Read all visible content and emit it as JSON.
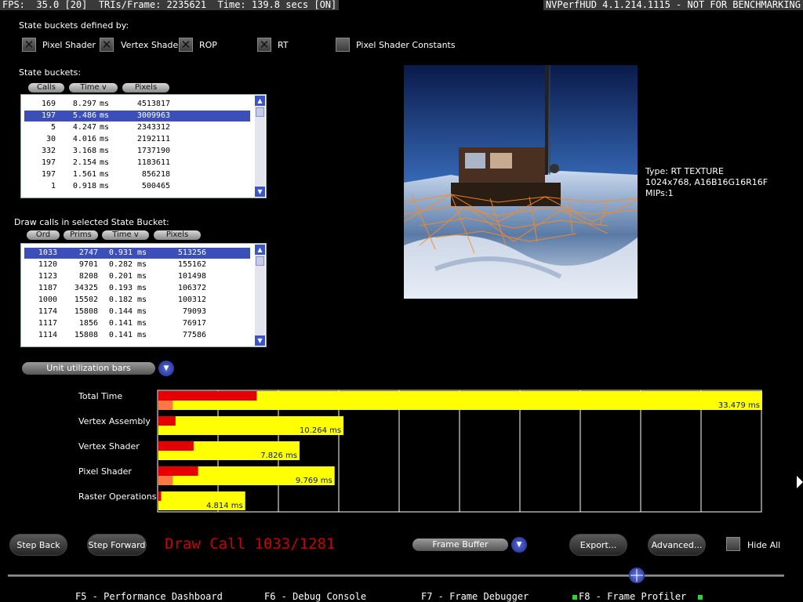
{
  "topbar": {
    "stats": "FPS:  35.0 [20]  TRIs/Frame: 2235621  Time: 139.8 secs [ON]",
    "version": "NVPerfHUD 4.1.214.1115 - NOT FOR BENCHMARKING"
  },
  "state_defined": {
    "title": "State buckets defined by:",
    "options": [
      {
        "label": "Pixel Shader",
        "checked": true
      },
      {
        "label": "Vertex Shader",
        "checked": true
      },
      {
        "label": "ROP",
        "checked": true
      },
      {
        "label": "RT",
        "checked": true
      },
      {
        "label": "Pixel Shader Constants",
        "checked": false
      }
    ]
  },
  "state_buckets": {
    "title": "State buckets:",
    "columns": [
      "Calls",
      "Time v",
      "Pixels"
    ],
    "rows": [
      [
        "169",
        "8.297",
        "ms",
        "4513817"
      ],
      [
        "197",
        "5.486",
        "ms",
        "3009963"
      ],
      [
        "5",
        "4.247",
        "ms",
        "2343312"
      ],
      [
        "30",
        "4.016",
        "ms",
        "2192111"
      ],
      [
        "332",
        "3.168",
        "ms",
        "1737190"
      ],
      [
        "197",
        "2.154",
        "ms",
        "1183611"
      ],
      [
        "197",
        "1.561",
        "ms",
        "856218"
      ],
      [
        "1",
        "0.918",
        "ms",
        "500465"
      ]
    ],
    "selected_row": 1
  },
  "draw_calls": {
    "title": "Draw calls in selected State Bucket:",
    "columns": [
      "Ord",
      "Prims",
      "Time v",
      "Pixels"
    ],
    "rows": [
      [
        "1033",
        "2747",
        "0.931",
        "ms",
        "513256"
      ],
      [
        "1120",
        "9701",
        "0.282",
        "ms",
        "155162"
      ],
      [
        "1123",
        "8208",
        "0.201",
        "ms",
        "101498"
      ],
      [
        "1187",
        "34325",
        "0.193",
        "ms",
        "106372"
      ],
      [
        "1000",
        "15502",
        "0.182",
        "ms",
        "100312"
      ],
      [
        "1174",
        "15808",
        "0.144",
        "ms",
        "79093"
      ],
      [
        "1117",
        "1856",
        "0.141",
        "ms",
        "76917"
      ],
      [
        "1114",
        "15808",
        "0.141",
        "ms",
        "77586"
      ]
    ],
    "selected_row": 0
  },
  "texture_info": {
    "type": "Type: RT  TEXTURE",
    "format": "1024x768, A16B16G16R16F",
    "mips": "MIPs:1"
  },
  "unit_dropdown": {
    "value": "Unit utilization bars"
  },
  "chart_data": {
    "type": "bar",
    "orientation": "horizontal",
    "categories": [
      "Total Time",
      "Vertex Assembly",
      "Vertex Shader",
      "Pixel Shader",
      "Raster Operations"
    ],
    "series": [
      {
        "values": [
          33.479,
          10.264,
          7.826,
          9.769,
          4.814
        ],
        "color": "#ffff00"
      },
      {
        "values": [
          5.45,
          0.95,
          1.95,
          2.2,
          0.15
        ],
        "color": "#e60000"
      },
      {
        "values": [
          0.8,
          0,
          0,
          0.8,
          0
        ],
        "color": "#ff7744"
      }
    ],
    "value_labels": [
      "33.479 ms",
      "10.264 ms",
      "7.826 ms",
      "9.769 ms",
      "4.814 ms"
    ],
    "xlim": [
      0,
      33.479
    ],
    "grid": true
  },
  "bottom": {
    "step_back": "Step Back",
    "step_forward": "Step Forward",
    "draw_call": "Draw Call 1033/1281",
    "buffer_dropdown": "Frame Buffer",
    "export": "Export...",
    "advanced": "Advanced...",
    "hide_all": "Hide All",
    "slider_fraction": 0.81
  },
  "fkeys": [
    "F5 - Performance Dashboard",
    "F6 - Debug Console",
    "F7 - Frame Debugger",
    "F8 - Frame Profiler"
  ],
  "colors": {
    "accent": "#3c4fb8",
    "draw_call_text": "#cc0000",
    "bar_yellow": "#ffff00",
    "bar_red": "#e60000"
  }
}
